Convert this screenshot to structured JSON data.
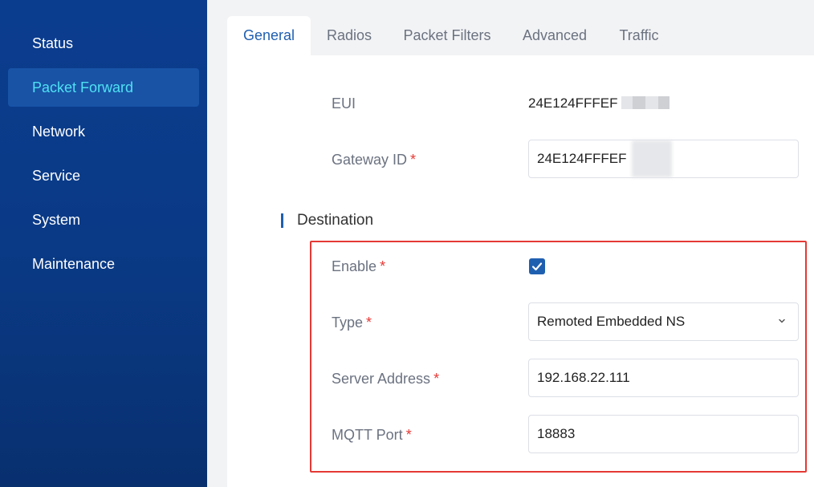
{
  "sidebar": {
    "items": [
      {
        "label": "Status",
        "active": false
      },
      {
        "label": "Packet Forward",
        "active": true
      },
      {
        "label": "Network",
        "active": false
      },
      {
        "label": "Service",
        "active": false
      },
      {
        "label": "System",
        "active": false
      },
      {
        "label": "Maintenance",
        "active": false
      }
    ]
  },
  "tabs": [
    {
      "label": "General",
      "active": true
    },
    {
      "label": "Radios",
      "active": false
    },
    {
      "label": "Packet Filters",
      "active": false
    },
    {
      "label": "Advanced",
      "active": false
    },
    {
      "label": "Traffic",
      "active": false
    }
  ],
  "form": {
    "eui": {
      "label": "EUI",
      "value": "24E124FFFEF"
    },
    "gateway_id": {
      "label": "Gateway ID",
      "required_mark": "*",
      "value": "24E124FFFEF"
    },
    "destination": {
      "title": "Destination",
      "enable": {
        "label": "Enable",
        "required_mark": "*",
        "checked": true
      },
      "type": {
        "label": "Type",
        "required_mark": "*",
        "value": "Remoted Embedded NS"
      },
      "server_address": {
        "label": "Server Address",
        "required_mark": "*",
        "value": "192.168.22.111"
      },
      "mqtt_port": {
        "label": "MQTT Port",
        "required_mark": "*",
        "value": "18883"
      }
    }
  },
  "colors": {
    "accent": "#1f5fb0",
    "sidebar_bg": "#0b3d8f",
    "active_nav_text": "#4fe0f2",
    "required": "#e53935",
    "highlight": "#e53935"
  }
}
